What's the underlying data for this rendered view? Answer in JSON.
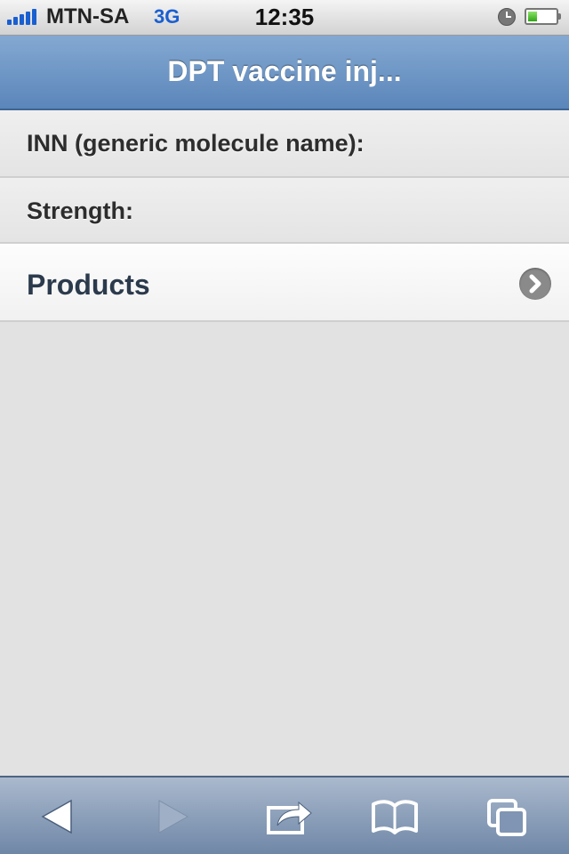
{
  "status_bar": {
    "carrier": "MTN-SA",
    "network": "3G",
    "time": "12:35"
  },
  "nav": {
    "title": "DPT vaccine inj..."
  },
  "rows": {
    "inn_label": "INN (generic molecule name):",
    "strength_label": "Strength:",
    "products_label": "Products"
  },
  "toolbar": {
    "icons": [
      "back-arrow-icon",
      "forward-arrow-icon",
      "share-icon",
      "bookmarks-icon",
      "pages-icon"
    ]
  },
  "colors": {
    "nav_bar": "#6a93c4",
    "network_blue": "#1a5fd0",
    "background": "#e2e2e2"
  }
}
